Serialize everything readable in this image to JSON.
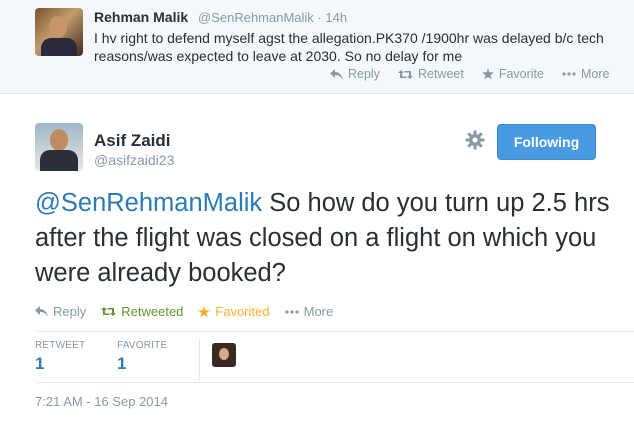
{
  "parent_tweet": {
    "name": "Rehman Malik",
    "handle_time": "@SenRehmanMalik · 14h",
    "text": "I hv right to defend myself agst the allegation.PK370 /1900hr was delayed b/c tech reasons/was expected to leave at 2030. So no delay for me",
    "actions": {
      "reply": "Reply",
      "retweet": "Retweet",
      "favorite": "Favorite",
      "more": "More"
    }
  },
  "tweet": {
    "name": "Asif Zaidi",
    "handle": "@asifzaidi23",
    "follow_label": "Following",
    "mention": "@SenRehmanMalik",
    "text_rest": " So how do you turn up 2.5 hrs after the flight was closed on a flight on which you were already booked?",
    "actions": {
      "reply": "Reply",
      "retweeted": "Retweeted",
      "favorited": "Favorited",
      "more": "More"
    },
    "stats": {
      "retweet_label": "RETWEET",
      "retweet_count": "1",
      "favorite_label": "FAVORITE",
      "favorite_count": "1"
    },
    "timestamp": "7:21 AM - 16 Sep 2014"
  },
  "colors": {
    "link": "#2b7bb9",
    "follow_button": "#4a9ae1",
    "retweeted": "#609928",
    "favorited": "#ffac33",
    "muted": "#8899a6"
  },
  "icons": [
    "reply-icon",
    "retweet-icon",
    "favorite-star-icon",
    "more-dots-icon",
    "gear-icon"
  ]
}
